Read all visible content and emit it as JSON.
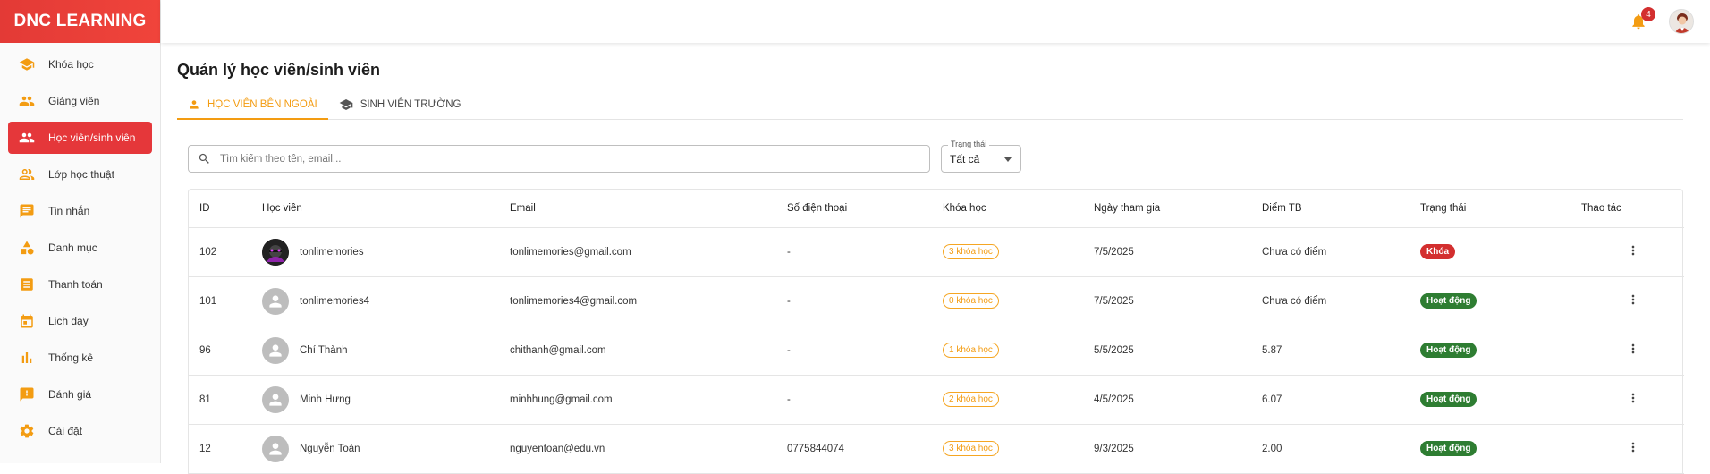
{
  "brand": "DNC LEARNING",
  "sidebar": {
    "items": [
      {
        "label": "Khóa học",
        "icon": "school-icon"
      },
      {
        "label": "Giảng viên",
        "icon": "people-icon"
      },
      {
        "label": "Học viên/sinh viên",
        "icon": "people-icon",
        "active": true
      },
      {
        "label": "Lớp học thuật",
        "icon": "group-icon"
      },
      {
        "label": "Tin nhắn",
        "icon": "chat-icon"
      },
      {
        "label": "Danh mục",
        "icon": "category-icon"
      },
      {
        "label": "Thanh toán",
        "icon": "receipt-icon"
      },
      {
        "label": "Lịch dạy",
        "icon": "calendar-icon"
      },
      {
        "label": "Thống kê",
        "icon": "bar-chart-icon"
      },
      {
        "label": "Đánh giá",
        "icon": "feedback-icon"
      },
      {
        "label": "Cài đặt",
        "icon": "gear-icon"
      }
    ]
  },
  "topbar": {
    "notification_count": "4"
  },
  "page": {
    "title": "Quản lý học viên/sinh viên"
  },
  "tabs": [
    {
      "label": "HỌC VIÊN BÊN NGOÀI",
      "active": true
    },
    {
      "label": "SINH VIÊN TRƯỜNG",
      "active": false
    }
  ],
  "search": {
    "placeholder": "Tìm kiếm theo tên, email..."
  },
  "filter": {
    "label": "Trạng thái",
    "value": "Tất cả"
  },
  "table": {
    "headers": [
      "ID",
      "Học viên",
      "Email",
      "Số điện thoại",
      "Khóa học",
      "Ngày tham gia",
      "Điểm TB",
      "Trạng thái",
      "Thao tác"
    ],
    "rows": [
      {
        "id": "102",
        "name": "tonlimemories",
        "email": "tonlimemories@gmail.com",
        "phone": "-",
        "courses": "3 khóa học",
        "joined": "7/5/2025",
        "score": "Chưa có điểm",
        "status": "Khóa",
        "avatar": "photo"
      },
      {
        "id": "101",
        "name": "tonlimemories4",
        "email": "tonlimemories4@gmail.com",
        "phone": "-",
        "courses": "0 khóa học",
        "joined": "7/5/2025",
        "score": "Chưa có điểm",
        "status": "Hoạt động",
        "avatar": "default"
      },
      {
        "id": "96",
        "name": "Chí Thành",
        "email": "chithanh@gmail.com",
        "phone": "-",
        "courses": "1 khóa học",
        "joined": "5/5/2025",
        "score": "5.87",
        "status": "Hoạt động",
        "avatar": "default"
      },
      {
        "id": "81",
        "name": "Minh Hưng",
        "email": "minhhung@gmail.com",
        "phone": "-",
        "courses": "2 khóa học",
        "joined": "4/5/2025",
        "score": "6.07",
        "status": "Hoạt động",
        "avatar": "default"
      },
      {
        "id": "12",
        "name": "Nguyễn Toàn",
        "email": "nguyentoan@edu.vn",
        "phone": "0775844074",
        "courses": "3 khóa học",
        "joined": "9/3/2025",
        "score": "2.00",
        "status": "Hoạt động",
        "avatar": "default"
      }
    ]
  },
  "colors": {
    "accent": "#e5373a",
    "orange": "#f39c12",
    "locked": "#d32f2f",
    "active": "#2e7d32"
  }
}
